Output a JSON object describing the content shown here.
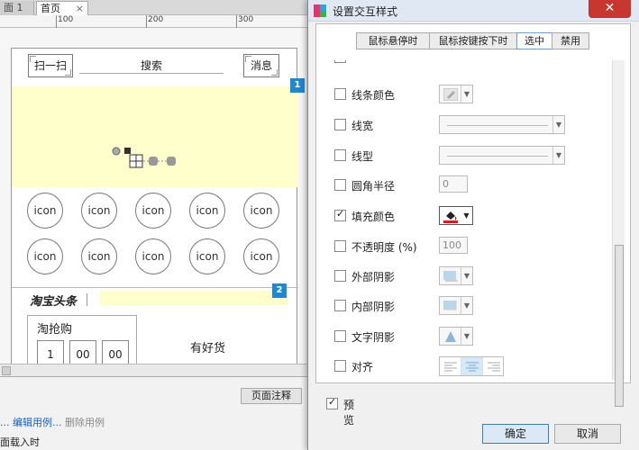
{
  "editor": {
    "tabs": [
      "面 1",
      "首页"
    ],
    "tab_close": "×",
    "ruler_labels": [
      "100",
      "200",
      "300"
    ],
    "header": {
      "scan": "扫一扫",
      "search": "搜索",
      "message": "消息"
    },
    "badges": [
      "1",
      "2"
    ],
    "icon_label": "icon",
    "headline": "淘宝头条",
    "flash_sale": {
      "title": "淘抢购",
      "times": [
        "1",
        "00",
        "00"
      ]
    },
    "good_goods": "有好货",
    "bottom": {
      "page_notes_tab": "页面注释",
      "edit_case": "... 编辑用例...",
      "delete_case": "删除用例",
      "load_text": "面载入时"
    }
  },
  "dialog": {
    "title": "设置交互样式",
    "close": "✕",
    "tabs": [
      "鼠标悬停时",
      "鼠标按键按下时",
      "选中",
      "禁用"
    ],
    "active_tab": 2,
    "rows": [
      {
        "label": "线条颜色",
        "checked": false
      },
      {
        "label": "线宽",
        "checked": false
      },
      {
        "label": "线型",
        "checked": false
      },
      {
        "label": "圆角半径",
        "checked": false,
        "value": "0"
      },
      {
        "label": "填充颜色",
        "checked": true
      },
      {
        "label": "不透明度 (%)",
        "checked": false,
        "value": "100"
      },
      {
        "label": "外部阴影",
        "checked": false
      },
      {
        "label": "内部阴影",
        "checked": false
      },
      {
        "label": "文字阴影",
        "checked": false
      },
      {
        "label": "对齐",
        "checked": false
      }
    ],
    "fill_color": "#e8121b",
    "preview": {
      "label": "预览",
      "checked": true
    },
    "ok": "确定",
    "cancel": "取消"
  }
}
